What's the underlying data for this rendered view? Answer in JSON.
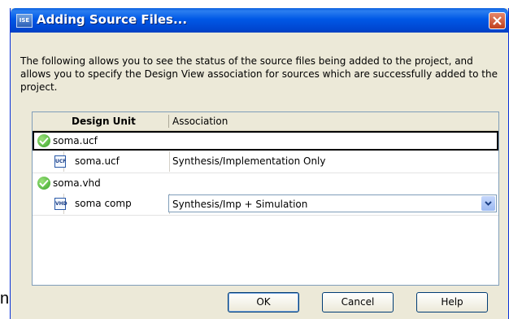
{
  "background_fragment": "n",
  "dialog": {
    "title": "Adding Source Files...",
    "app_icon_text": "ISE",
    "description": "The following allows you to see the status of the source files being added to the project, and allows you to specify the Design View association for sources which are successfully added to the project."
  },
  "table": {
    "columns": [
      "Design Unit",
      "Association"
    ],
    "files": [
      {
        "name": "soma.ucf",
        "status": "success",
        "unit": {
          "icon_text": "UCF",
          "label": "soma.ucf",
          "association": "Synthesis/Implementation Only",
          "is_dropdown": false
        }
      },
      {
        "name": "soma.vhd",
        "status": "success",
        "unit": {
          "icon_text": "VHD",
          "label": "soma comp",
          "association": "Synthesis/Imp + Simulation",
          "is_dropdown": true
        }
      }
    ]
  },
  "buttons": {
    "ok": "OK",
    "cancel": "Cancel",
    "help": "Help"
  },
  "colors": {
    "titlebar": "#0058e6",
    "dialog_bg": "#ece9d8",
    "close": "#c1401c",
    "check": "#3aa329"
  }
}
